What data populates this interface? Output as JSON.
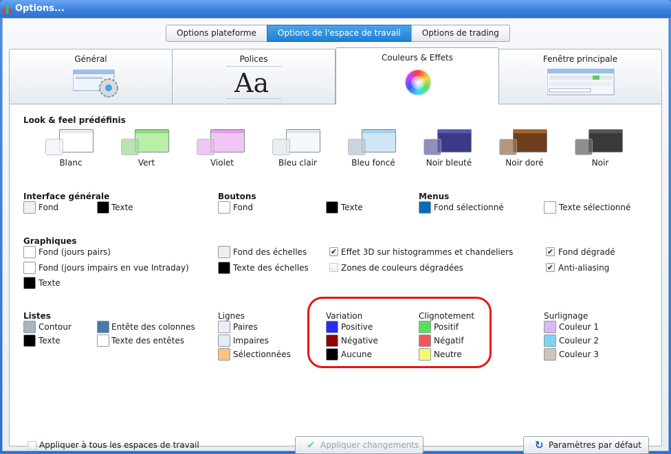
{
  "window": {
    "title": "Options..."
  },
  "top_tabs": [
    {
      "label": "Options plateforme"
    },
    {
      "label": "Options de l'espace de travail"
    },
    {
      "label": "Options de trading"
    }
  ],
  "sub_tabs": [
    {
      "label": "Général"
    },
    {
      "label": "Polices",
      "glyph": "Aa"
    },
    {
      "label": "Couleurs & Effets"
    },
    {
      "label": "Fenêtre principale"
    }
  ],
  "presets": {
    "title": "Look & feel prédéfinis",
    "items": [
      {
        "label": "Blanc",
        "color": "#ffffff"
      },
      {
        "label": "Vert",
        "color": "#b8f0a8"
      },
      {
        "label": "Violet",
        "color": "#f2c6f4"
      },
      {
        "label": "Bleu clair",
        "color": "#f4f8fb"
      },
      {
        "label": "Bleu foncé",
        "color": "#cfe6f5"
      },
      {
        "label": "Noir bleuté",
        "color": "#3c3a86"
      },
      {
        "label": "Noir doré",
        "color": "#6e3e1c"
      },
      {
        "label": "Noir",
        "color": "#3a3a3a"
      }
    ]
  },
  "interface": {
    "title": "Interface générale",
    "fond": "Fond",
    "texte": "Texte"
  },
  "boutons": {
    "title": "Boutons",
    "fond": "Fond",
    "texte": "Texte"
  },
  "menus": {
    "title": "Menus",
    "fond_sel": "Fond sélectionné",
    "texte_sel": "Texte sélectionné"
  },
  "graphiques": {
    "title": "Graphiques",
    "fond_pairs": "Fond (jours pairs)",
    "fond_impairs": "Fond (jours impairs en vue Intraday)",
    "texte": "Texte",
    "fond_echelles": "Fond des échelles",
    "texte_echelles": "Texte des échelles",
    "effet3d": "Effet 3D sur histogrammes et chandeliers",
    "zones": "Zones de couleurs dégradées",
    "fond_degrade": "Fond dégradé",
    "antialiasing": "Anti-aliasing"
  },
  "listes": {
    "title": "Listes",
    "contour": "Contour",
    "texte": "Texte",
    "entete_col": "Entête des colonnes",
    "texte_entetes": "Texte des entêtes"
  },
  "lignes": {
    "title": "Lignes",
    "paires": "Paires",
    "impaires": "Impaires",
    "selectionnees": "Sélectionnées"
  },
  "variation": {
    "title": "Variation",
    "positive": "Positive",
    "negative": "Négative",
    "aucune": "Aucune"
  },
  "clignotement": {
    "title": "Clignotement",
    "positif": "Positif",
    "negatif": "Négatif",
    "neutre": "Neutre"
  },
  "surlignage": {
    "title": "Surlignage",
    "c1": "Couleur 1",
    "c2": "Couleur 2",
    "c3": "Couleur 3"
  },
  "footer": {
    "apply_all": "Appliquer à tous les espaces de travail",
    "apply_changes": "Appliquer changements",
    "defaults": "Paramètres par défaut"
  },
  "colors": {
    "accent": "#1f7fd4",
    "menu_selected": "#0a6cb4",
    "variation_positive": "#2a2af5",
    "variation_negative": "#900000",
    "clign_positif": "#5cde5c",
    "clign_negatif": "#f05858",
    "clign_neutre": "#f8f870",
    "surlignage_1": "#d9b8f4",
    "surlignage_2": "#7fd4f6",
    "surlignage_3": "#cfc4bc",
    "highlight": "#ee1111"
  }
}
